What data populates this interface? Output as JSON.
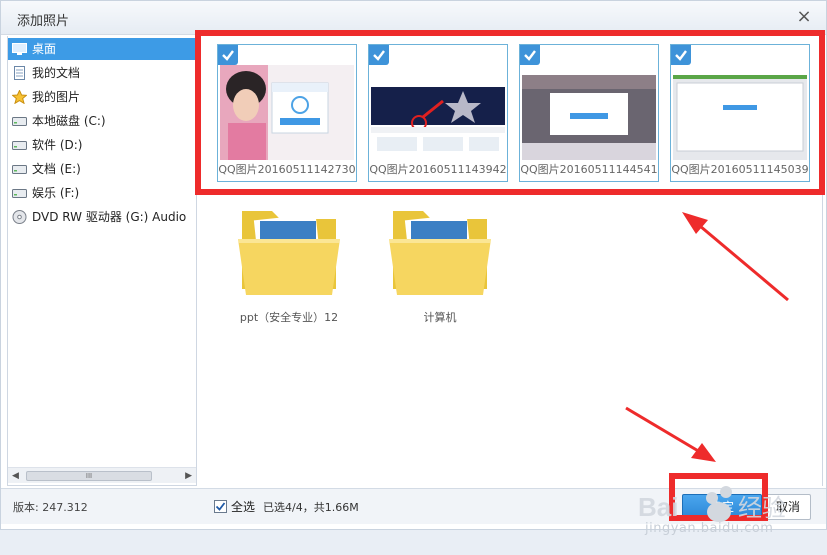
{
  "dialog": {
    "title": "添加照片",
    "close_label": "×"
  },
  "sidebar": {
    "items": [
      {
        "label": "桌面",
        "icon": "desktop-icon"
      },
      {
        "label": "我的文档",
        "icon": "document-icon"
      },
      {
        "label": "我的图片",
        "icon": "star-icon"
      },
      {
        "label": "本地磁盘 (C:)",
        "icon": "drive-icon"
      },
      {
        "label": "软件 (D:)",
        "icon": "drive-icon"
      },
      {
        "label": "文档 (E:)",
        "icon": "drive-icon"
      },
      {
        "label": "娱乐 (F:)",
        "icon": "drive-icon"
      },
      {
        "label": "DVD RW 驱动器 (G:) Audio",
        "icon": "dvd-icon"
      }
    ],
    "scrollbar_grip": "III"
  },
  "photos": [
    {
      "name": "QQ图片20160511142730",
      "checked": true
    },
    {
      "name": "QQ图片20160511143942",
      "checked": true
    },
    {
      "name": "QQ图片20160511144541",
      "checked": true
    },
    {
      "name": "QQ图片20160511145039",
      "checked": true
    }
  ],
  "folders": [
    {
      "name": "ppt（安全专业）12"
    },
    {
      "name": "计算机"
    }
  ],
  "footer": {
    "version": "版本: 247.312",
    "select_all_label": "全选",
    "select_all_checked": true,
    "status": "已选4/4，共1.66M",
    "ok_label": "确定",
    "cancel_label": "取消"
  },
  "watermark": {
    "brand": "Bai 经验",
    "url": "jingyan.baidu.com"
  },
  "colors": {
    "accent": "#3d9be6",
    "annotation": "#ee2b2b",
    "selection_border": "#6cb2d9"
  }
}
